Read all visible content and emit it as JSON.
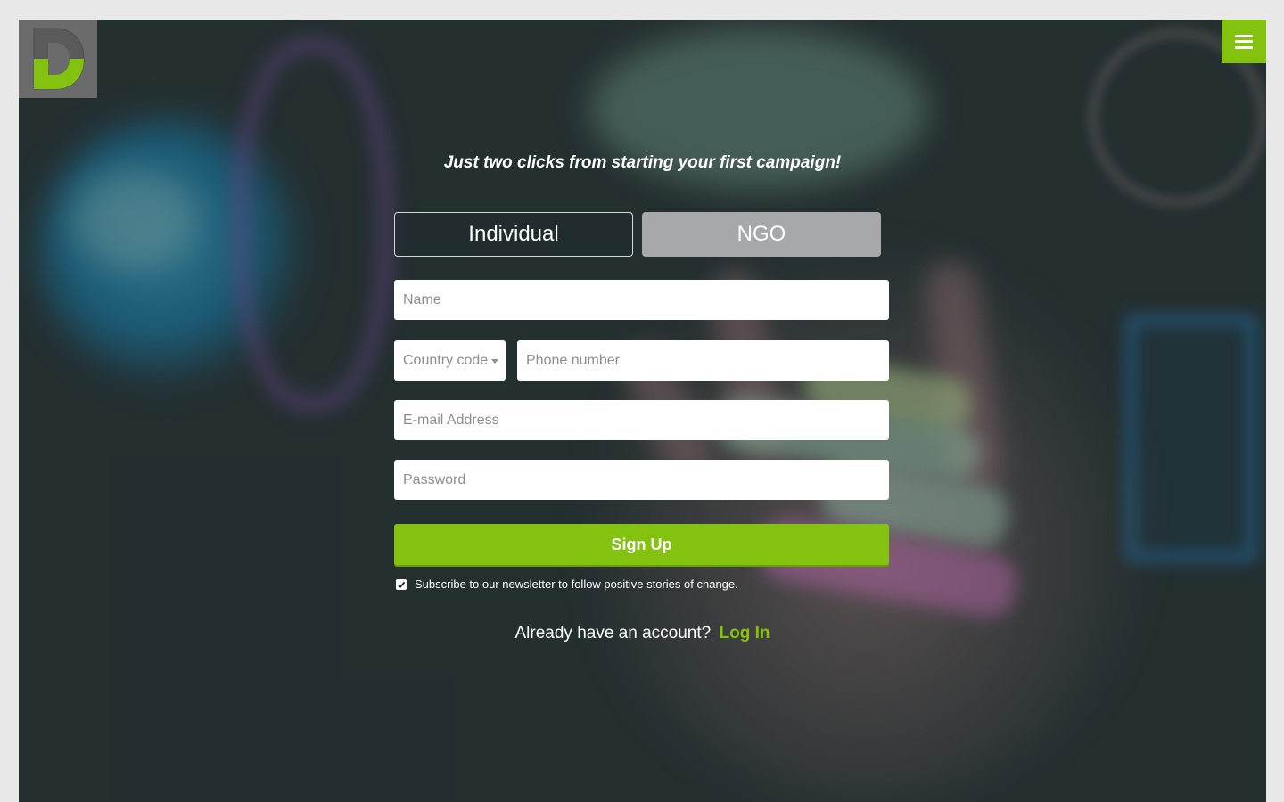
{
  "brand": {
    "logo_letter": "D",
    "accent_color": "#84c210",
    "logo_bg": "#6b6b6b"
  },
  "header": {
    "menu_icon": "hamburger-menu-icon"
  },
  "signup": {
    "tagline": "Just two clicks from starting your first campaign!",
    "tabs": [
      {
        "label": "Individual",
        "selected": true
      },
      {
        "label": "NGO",
        "selected": false
      }
    ],
    "fields": {
      "name_placeholder": "Name",
      "country_code_placeholder": "Country code",
      "phone_placeholder": "Phone number",
      "email_placeholder": "E-mail Address",
      "password_placeholder": "Password"
    },
    "submit_label": "Sign Up",
    "newsletter": {
      "checked": true,
      "label": "Subscribe to our newsletter to follow positive stories of change."
    },
    "login_prompt": "Already have an account?",
    "login_link": "Log In"
  }
}
